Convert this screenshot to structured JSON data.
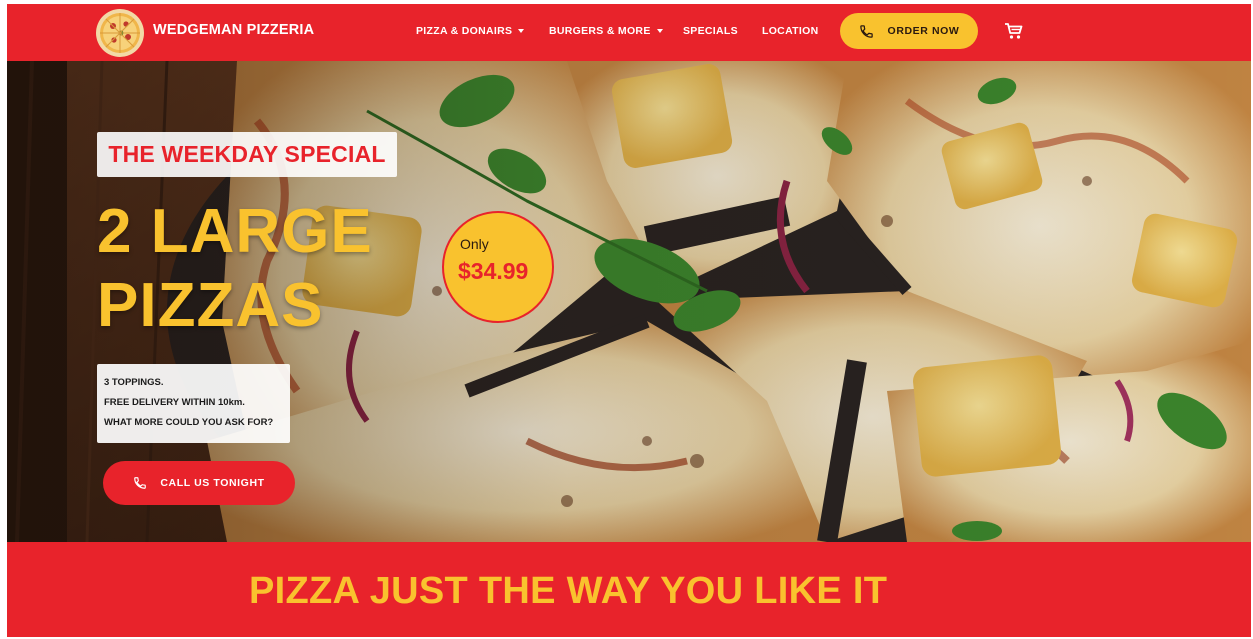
{
  "colors": {
    "brand_red": "#e8232b",
    "brand_yellow": "#f9c22e",
    "dark_text": "#1b1b1b",
    "white": "#ffffff"
  },
  "nav": {
    "brand": "WEDGEMAN PIZZERIA",
    "logo_icon": "pizza-logo-icon",
    "links": [
      {
        "label": "PIZZA & DONAIRS",
        "dropdown": true
      },
      {
        "label": "BURGERS & MORE",
        "dropdown": true
      },
      {
        "label": "SPECIALS",
        "dropdown": false
      },
      {
        "label": "LOCATION",
        "dropdown": false
      }
    ],
    "order_button": {
      "label": "ORDER NOW",
      "icon": "phone-icon"
    },
    "cart_icon": "cart-icon"
  },
  "hero": {
    "tag": "THE WEEKDAY SPECIAL",
    "headline": [
      "2 LARGE",
      "PIZZAS"
    ],
    "price": {
      "prefix": "Only",
      "value": "$34.99"
    },
    "details": [
      "3 TOPPINGS.",
      "FREE DELIVERY WITHIN 10km.",
      "WHAT MORE COULD YOU ASK FOR?"
    ],
    "cta": {
      "label": "CALL US TONIGHT",
      "icon": "phone-icon"
    }
  },
  "banner": {
    "text": "PIZZA JUST THE WAY YOU LIKE IT"
  }
}
